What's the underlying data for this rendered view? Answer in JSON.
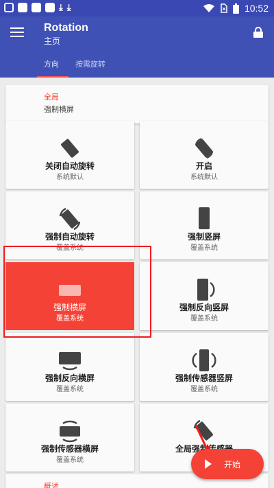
{
  "status_bar": {
    "time": "10:52",
    "icons": [
      "notification-icon",
      "image-icon",
      "image-icon",
      "image-icon",
      "download-icon",
      "download-icon",
      "wifi-icon",
      "no-sim-icon",
      "battery-icon"
    ]
  },
  "app_bar": {
    "title": "Rotation",
    "subtitle": "主页",
    "tabs": [
      {
        "label": "方向",
        "selected": true
      },
      {
        "label": "按需旋转",
        "selected": false
      }
    ]
  },
  "global": {
    "title": "全局",
    "value": "强制横屏"
  },
  "modes": [
    {
      "label": "关闭自动旋转",
      "sub": "系统默认",
      "icon": "phone-tilted-icon",
      "active": false
    },
    {
      "label": "开启",
      "sub": "系统默认",
      "icon": "phone-rotate-icon",
      "active": false
    },
    {
      "label": "强制自动旋转",
      "sub": "覆盖系统",
      "icon": "phone-auto-rotate-icon",
      "active": false
    },
    {
      "label": "强制竖屏",
      "sub": "覆盖系统",
      "icon": "phone-portrait-icon",
      "active": false
    },
    {
      "label": "强制横屏",
      "sub": "覆盖系统",
      "icon": "phone-landscape-icon",
      "active": true
    },
    {
      "label": "强制反向竖屏",
      "sub": "覆盖系统",
      "icon": "phone-reverse-portrait-icon",
      "active": false
    },
    {
      "label": "强制反向横屏",
      "sub": "覆盖系统",
      "icon": "phone-reverse-landscape-icon",
      "active": false
    },
    {
      "label": "强制传感器竖屏",
      "sub": "覆盖系统",
      "icon": "phone-sensor-portrait-icon",
      "active": false
    },
    {
      "label": "强制传感器横屏",
      "sub": "覆盖系统",
      "icon": "phone-sensor-landscape-icon",
      "active": false
    },
    {
      "label": "全局强制传感器",
      "sub": "",
      "icon": "phone-sensor-icon",
      "active": false
    }
  ],
  "summary": {
    "title": "概述"
  },
  "fab": {
    "label": "开始",
    "icon": "play-icon"
  },
  "colors": {
    "primary": "#3f51b5",
    "status_bar": "#3a48b3",
    "accent": "#f44336",
    "annotation": "#f21b1b"
  }
}
